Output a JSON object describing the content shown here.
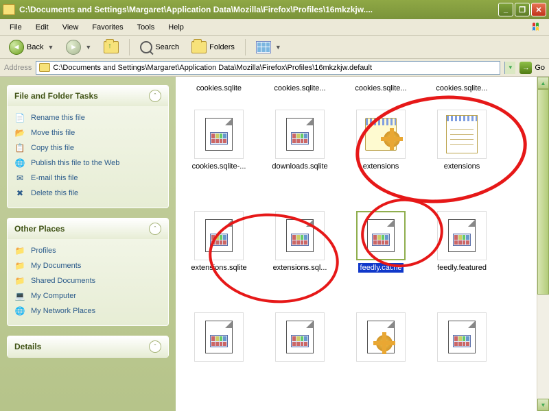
{
  "window": {
    "title": "C:\\Documents and Settings\\Margaret\\Application Data\\Mozilla\\Firefox\\Profiles\\16mkzkjw...."
  },
  "menubar": {
    "items": [
      "File",
      "Edit",
      "View",
      "Favorites",
      "Tools",
      "Help"
    ]
  },
  "toolbar": {
    "back": "Back",
    "search": "Search",
    "folders": "Folders"
  },
  "addressbar": {
    "label": "Address",
    "path": "C:\\Documents and Settings\\Margaret\\Application Data\\Mozilla\\Firefox\\Profiles\\16mkzkjw.default",
    "go": "Go"
  },
  "sidebar": {
    "panels": [
      {
        "title": "File and Folder Tasks",
        "tasks": [
          {
            "icon": "rename",
            "glyph": "📄",
            "label": "Rename this file"
          },
          {
            "icon": "move",
            "glyph": "📂",
            "label": "Move this file"
          },
          {
            "icon": "copy",
            "glyph": "📋",
            "label": "Copy this file"
          },
          {
            "icon": "publish",
            "glyph": "🌐",
            "label": "Publish this file to the Web"
          },
          {
            "icon": "email",
            "glyph": "✉",
            "label": "E-mail this file"
          },
          {
            "icon": "delete",
            "glyph": "✖",
            "label": "Delete this file"
          }
        ]
      },
      {
        "title": "Other Places",
        "tasks": [
          {
            "icon": "folder",
            "glyph": "📁",
            "label": "Profiles"
          },
          {
            "icon": "folder",
            "glyph": "📁",
            "label": "My Documents"
          },
          {
            "icon": "folder",
            "glyph": "📁",
            "label": "Shared Documents"
          },
          {
            "icon": "computer",
            "glyph": "💻",
            "label": "My Computer"
          },
          {
            "icon": "network",
            "glyph": "🌐",
            "label": "My Network Places"
          }
        ]
      },
      {
        "title": "Details",
        "collapsed": true
      }
    ]
  },
  "files": {
    "row0": [
      {
        "name": "cookies.sqlite",
        "type": "label-only"
      },
      {
        "name": "cookies.sqlite...",
        "type": "label-only"
      },
      {
        "name": "cookies.sqlite...",
        "type": "label-only"
      },
      {
        "name": "cookies.sqlite...",
        "type": "label-only"
      }
    ],
    "row1": [
      {
        "name": "cookies.sqlite-...",
        "type": "doc"
      },
      {
        "name": "downloads.sqlite",
        "type": "doc"
      },
      {
        "name": "extensions",
        "type": "note-gear"
      },
      {
        "name": "extensions",
        "type": "note-lines"
      }
    ],
    "row2": [
      {
        "name": "extensions.sqlite",
        "type": "doc"
      },
      {
        "name": "extensions.sql...",
        "type": "doc"
      },
      {
        "name": "feedly.cache",
        "type": "doc",
        "selected": true
      },
      {
        "name": "feedly.featured",
        "type": "doc"
      }
    ],
    "row3": [
      {
        "name": "",
        "type": "doc"
      },
      {
        "name": "",
        "type": "doc"
      },
      {
        "name": "",
        "type": "gear-doc"
      },
      {
        "name": "",
        "type": "doc"
      }
    ]
  }
}
